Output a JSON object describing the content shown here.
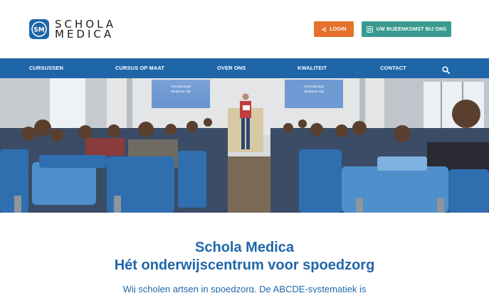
{
  "brand": {
    "logo_line1": "SCHOLA",
    "logo_line2": "MEDICA",
    "logo_monogram": "SM",
    "color_primary": "#1f66a9",
    "color_login": "#e4722a",
    "color_meeting": "#3a9a8f"
  },
  "header": {
    "login_label": "LOGIN",
    "login_icon": "sign-in-icon",
    "meeting_label": "UW BIJEENKOMST BIJ ONS",
    "meeting_icon": "meeting-icon"
  },
  "nav": {
    "items": [
      {
        "label": "CURSUSSEN"
      },
      {
        "label": "CURSUS OP MAAT"
      },
      {
        "label": "OVER ONS"
      },
      {
        "label": "KWALITEIT"
      },
      {
        "label": "CONTACT"
      }
    ],
    "search_icon": "search-icon"
  },
  "hero": {
    "slide_left": [
      "Traumatologie",
      "Medische stijl"
    ],
    "slide_right": [
      "Traumatologie",
      "Medische stijl"
    ]
  },
  "intro": {
    "title_line1": "Schola Medica",
    "title_line2": "Hét onderwijscentrum voor spoedzorg",
    "text": "Wij scholen artsen in spoedzorg. De ABCDE-systematiek is"
  }
}
